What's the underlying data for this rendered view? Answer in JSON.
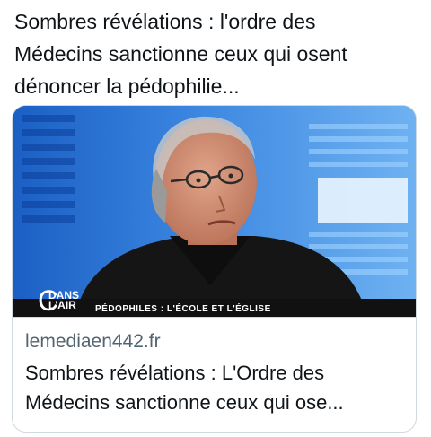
{
  "tweet": {
    "text": "Sombres révélations : l'ordre des\nMédecins sanctionne ceux qui osent\ndénoncer la pédophilie..."
  },
  "card": {
    "domain": "lemediaen442.fr",
    "title": "Sombres révélations : L'Ordre des\nMédecins sanctionne ceux qui ose...",
    "image": {
      "logo_line1": "DANS",
      "logo_line2": "L'AIR",
      "caption": "PÉDOPHILES : L'ÉCOLE ET L'ÉGLISE"
    }
  }
}
